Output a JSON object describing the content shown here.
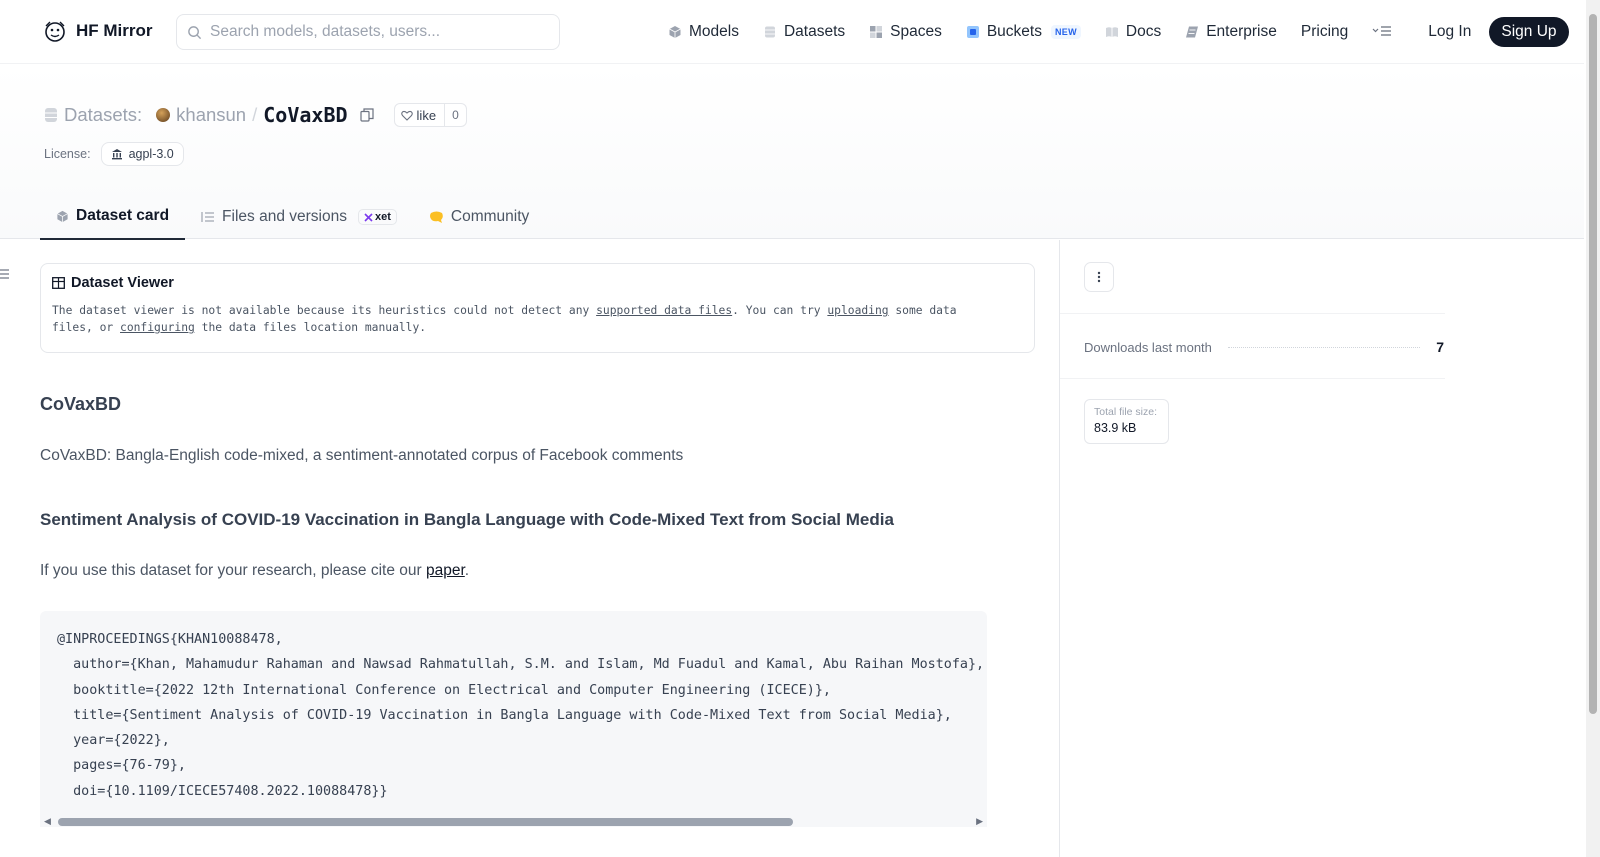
{
  "header": {
    "brand": "HF Mirror",
    "search_placeholder": "Search models, datasets, users...",
    "nav": [
      {
        "label": "Models",
        "icon": "cube-icon"
      },
      {
        "label": "Datasets",
        "icon": "database-icon"
      },
      {
        "label": "Spaces",
        "icon": "grid-icon"
      },
      {
        "label": "Buckets",
        "icon": "bucket-icon",
        "badge": "NEW"
      },
      {
        "label": "Docs",
        "icon": "book-icon"
      },
      {
        "label": "Enterprise",
        "icon": "enterprise-icon"
      },
      {
        "label": "Pricing"
      }
    ],
    "login": "Log In",
    "signup": "Sign Up"
  },
  "repo": {
    "type_label": "Datasets:",
    "owner": "khansun",
    "separator": "/",
    "name": "CoVaxBD",
    "like_label": "like",
    "like_count": "0",
    "license_label": "License:",
    "license_value": "agpl-3.0"
  },
  "tabs": [
    {
      "label": "Dataset card",
      "active": true
    },
    {
      "label": "Files and versions",
      "badge": "xet"
    },
    {
      "label": "Community"
    }
  ],
  "viewer": {
    "title": "Dataset Viewer",
    "text_1": "The dataset viewer is not available because its heuristics could not detect any ",
    "link_1": "supported data files",
    "text_2": ". You can try ",
    "link_2": "uploading",
    "text_3": " some data",
    "text_4": "files, or ",
    "link_3": "configuring",
    "text_5": " the data files location manually."
  },
  "card": {
    "heading": "CoVaxBD",
    "intro": "CoVaxBD: Bangla-English code-mixed, a sentiment-annotated corpus of Facebook comments",
    "subheading": "Sentiment Analysis of COVID-19 Vaccination in Bangla Language with Code-Mixed Text from Social Media",
    "cite_prefix": "If you use this dataset for your research, please cite our ",
    "cite_link": "paper",
    "cite_suffix": ".",
    "bibtex": "@INPROCEEDINGS{KHAN10088478,\n  author={Khan, Mahamudur Rahaman and Nawsad Rahmatullah, S.M. and Islam, Md Fuadul and Kamal, Abu Raihan Mostofa},\n  booktitle={2022 12th International Conference on Electrical and Computer Engineering (ICECE)},\n  title={Sentiment Analysis of COVID-19 Vaccination in Bangla Language with Code-Mixed Text from Social Media},\n  year={2022},\n  pages={76-79},\n  doi={10.1109/ICECE57408.2022.10088478}}"
  },
  "sidebar": {
    "downloads_label": "Downloads last month",
    "downloads_value": "7",
    "size_label": "Total file size:",
    "size_value": "83.9 kB"
  },
  "colors": {
    "accent": "#111827",
    "new_badge": "#2563eb",
    "community": "#fbbf24"
  }
}
